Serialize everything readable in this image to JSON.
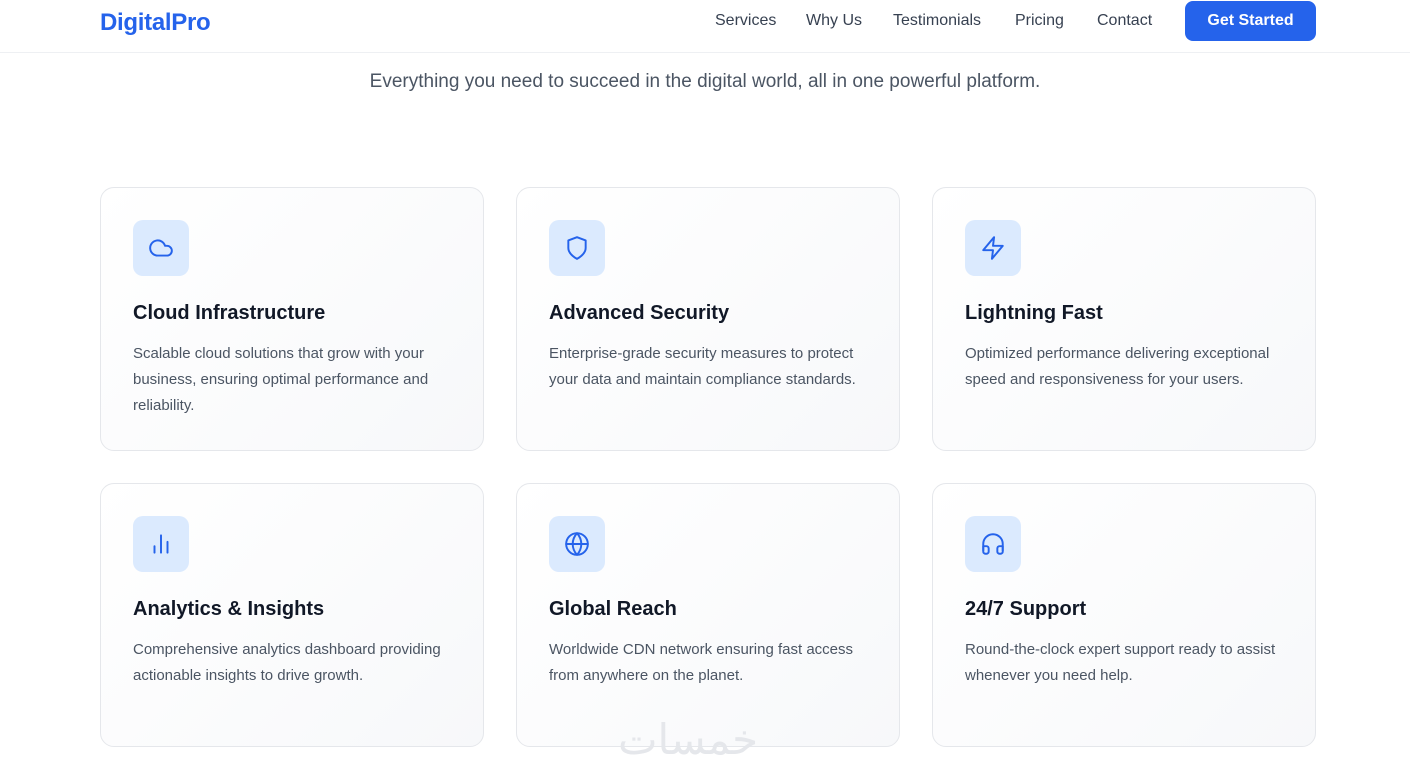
{
  "nav": {
    "brand": "DigitalPro",
    "links": [
      "Services",
      "Why Us",
      "Testimonials",
      "Pricing",
      "Contact"
    ],
    "cta": "Get Started"
  },
  "hero": {
    "subtitle": "Everything you need to succeed in the digital world, all in one powerful platform."
  },
  "features": [
    {
      "icon": "cloud-icon",
      "title": "Cloud Infrastructure",
      "description": "Scalable cloud solutions that grow with your business, ensuring optimal performance and reliability."
    },
    {
      "icon": "shield-icon",
      "title": "Advanced Security",
      "description": "Enterprise-grade security measures to protect your data and maintain compliance standards."
    },
    {
      "icon": "lightning-icon",
      "title": "Lightning Fast",
      "description": "Optimized performance delivering exceptional speed and responsiveness for your users."
    },
    {
      "icon": "bar-chart-icon",
      "title": "Analytics & Insights",
      "description": "Comprehensive analytics dashboard providing actionable insights to drive growth."
    },
    {
      "icon": "globe-icon",
      "title": "Global Reach",
      "description": "Worldwide CDN network ensuring fast access from anywhere on the planet."
    },
    {
      "icon": "headphones-icon",
      "title": "24/7 Support",
      "description": "Round-the-clock expert support ready to assist whenever you need help."
    }
  ],
  "watermark": "خمسات",
  "colors": {
    "accent": "#2563eb",
    "icon_bg": "#dbeafe",
    "text_dark": "#111827",
    "text_muted": "#4b5563"
  }
}
